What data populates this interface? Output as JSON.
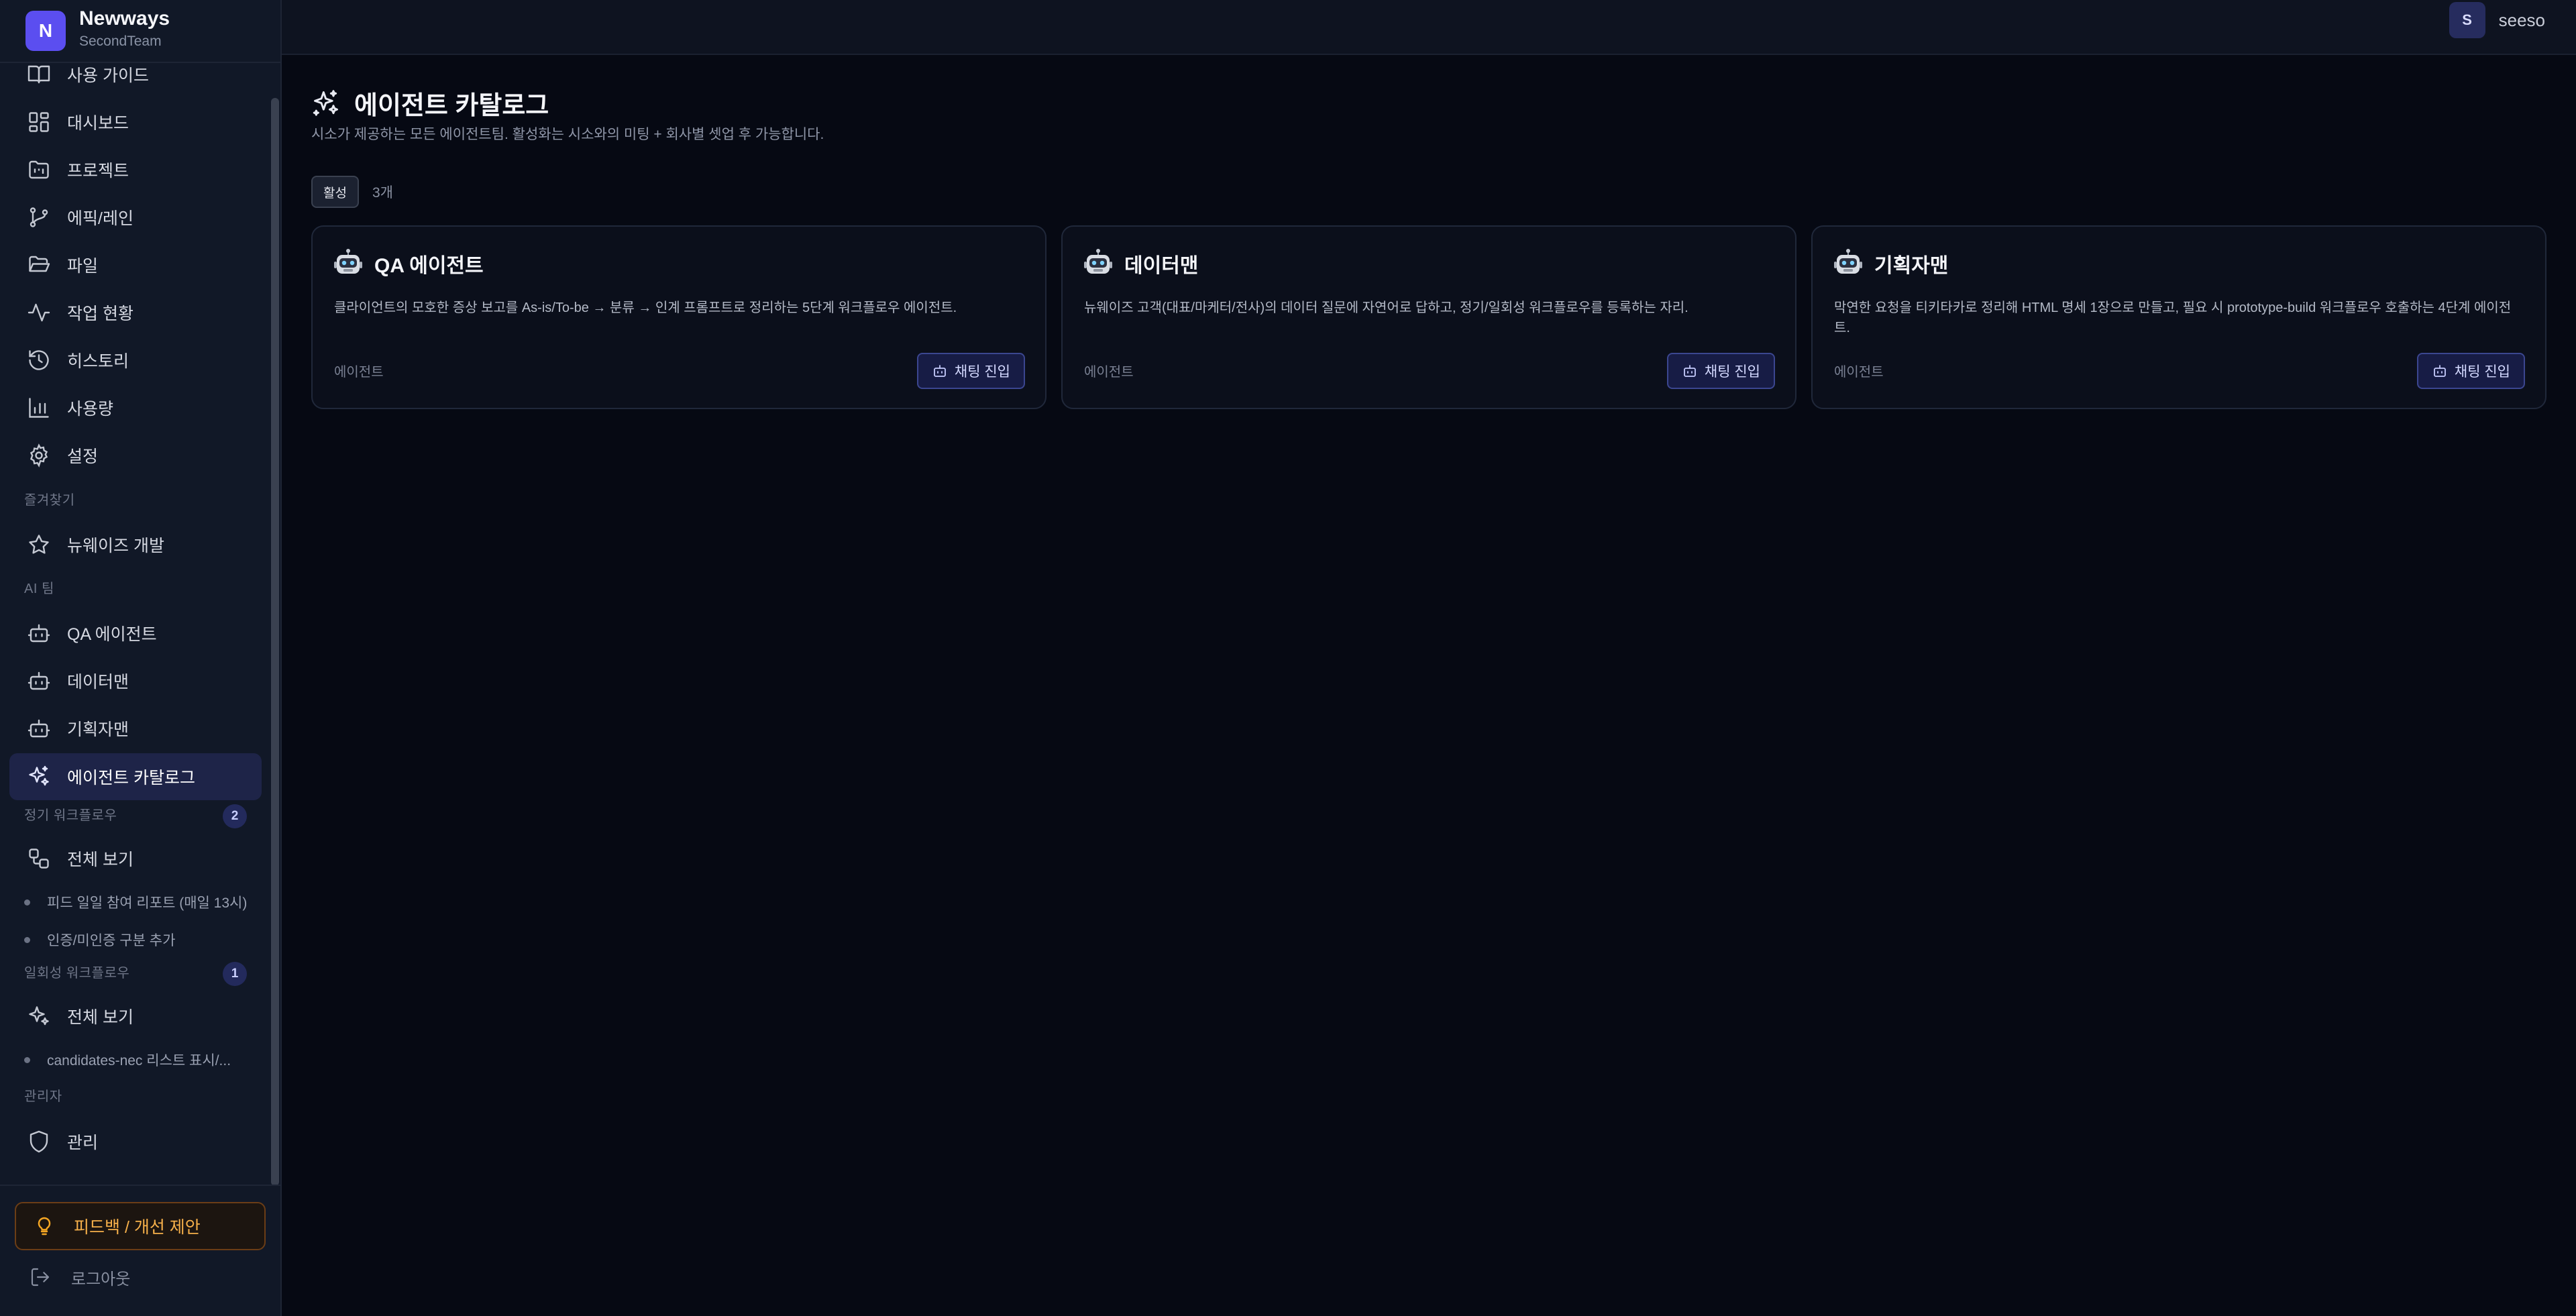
{
  "brand": {
    "logo_letter": "N",
    "name": "Newways",
    "team": "SecondTeam"
  },
  "nav": {
    "items": [
      {
        "label": "사용 가이드",
        "icon": "book-open-icon"
      },
      {
        "label": "대시보드",
        "icon": "dashboard-grid-icon"
      },
      {
        "label": "프로젝트",
        "icon": "folder-kanban-icon"
      },
      {
        "label": "에픽/레인",
        "icon": "git-branch-icon"
      },
      {
        "label": "파일",
        "icon": "folder-open-icon"
      },
      {
        "label": "작업 현황",
        "icon": "activity-icon"
      },
      {
        "label": "히스토리",
        "icon": "history-icon"
      },
      {
        "label": "사용량",
        "icon": "bar-chart-icon"
      },
      {
        "label": "설정",
        "icon": "gear-icon"
      }
    ],
    "favorites": {
      "section": "즐겨찾기",
      "items": [
        {
          "label": "뉴웨이즈 개발",
          "icon": "star-icon"
        }
      ]
    },
    "ai_team": {
      "section": "AI 팀",
      "items": [
        {
          "label": "QA 에이전트",
          "icon": "bot-icon"
        },
        {
          "label": "데이터맨",
          "icon": "bot-icon"
        },
        {
          "label": "기획자맨",
          "icon": "bot-icon"
        },
        {
          "label": "에이전트 카탈로그",
          "icon": "sparkles-icon",
          "active": true
        }
      ]
    },
    "recurring": {
      "section": "정기 워크플로우",
      "count": "2",
      "view_all": "전체 보기",
      "items": [
        "피드 일일 참여 리포트 (매일 13시)",
        "인증/미인증 구분 추가"
      ]
    },
    "oneoff": {
      "section": "일회성 워크플로우",
      "count": "1",
      "view_all": "전체 보기",
      "items": [
        "candidates-nec 리스트 표시/..."
      ]
    },
    "admin": {
      "section": "관리자",
      "items": [
        {
          "label": "관리",
          "icon": "shield-icon"
        }
      ]
    }
  },
  "footer": {
    "feedback": "피드백 / 개선 제안",
    "logout": "로그아웃"
  },
  "user": {
    "initial": "S",
    "name": "seeso"
  },
  "page": {
    "title": "에이전트 카탈로그",
    "description": "시소가 제공하는 모든 에이전트팀. 활성화는 시소와의 미팅 + 회사별 셋업 후 가능합니다.",
    "filter_label": "활성",
    "count_label": "3개"
  },
  "agents": [
    {
      "name": "QA 에이전트",
      "description": "클라이언트의 모호한 증상 보고를 As-is/To-be → 분류 → 인계 프롬프트로 정리하는 5단계 워크플로우 에이전트.",
      "kind": "에이전트",
      "action": "채팅 진입"
    },
    {
      "name": "데이터맨",
      "description": "뉴웨이즈 고객(대표/마케터/전사)의 데이터 질문에 자연어로 답하고, 정기/일회성 워크플로우를 등록하는 자리.",
      "kind": "에이전트",
      "action": "채팅 진입"
    },
    {
      "name": "기획자맨",
      "description": "막연한 요청을 티키타카로 정리해 HTML 명세 1장으로 만들고, 필요 시 prototype-build 워크플로우 호출하는 4단계 에이전트.",
      "kind": "에이전트",
      "action": "채팅 진입"
    }
  ],
  "colors": {
    "accent": "#5b4ef0",
    "sidebar_bg": "#111827",
    "main_bg": "#060913",
    "active_item_bg": "#1e2448",
    "feedback_text": "#f6b04a"
  }
}
